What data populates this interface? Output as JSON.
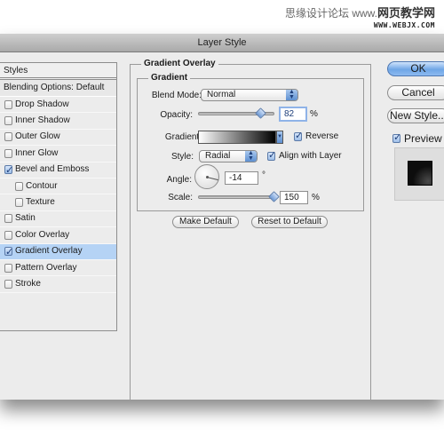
{
  "watermark": {
    "line1_prefix": "思缘设计论坛",
    "line1_www": "www.",
    "line1_site": "网页教学网",
    "line2": "WWW.WEBJX.COM"
  },
  "window": {
    "title": "Layer Style"
  },
  "styles_list": {
    "header": "Styles",
    "blending_options": "Blending Options: Default",
    "items": [
      {
        "label": "Drop Shadow",
        "checked": false,
        "sub": false,
        "selected": false
      },
      {
        "label": "Inner Shadow",
        "checked": false,
        "sub": false,
        "selected": false
      },
      {
        "label": "Outer Glow",
        "checked": false,
        "sub": false,
        "selected": false
      },
      {
        "label": "Inner Glow",
        "checked": false,
        "sub": false,
        "selected": false
      },
      {
        "label": "Bevel and Emboss",
        "checked": true,
        "sub": false,
        "selected": false
      },
      {
        "label": "Contour",
        "checked": false,
        "sub": true,
        "selected": false
      },
      {
        "label": "Texture",
        "checked": false,
        "sub": true,
        "selected": false
      },
      {
        "label": "Satin",
        "checked": false,
        "sub": false,
        "selected": false
      },
      {
        "label": "Color Overlay",
        "checked": false,
        "sub": false,
        "selected": false
      },
      {
        "label": "Gradient Overlay",
        "checked": true,
        "sub": false,
        "selected": true
      },
      {
        "label": "Pattern Overlay",
        "checked": false,
        "sub": false,
        "selected": false
      },
      {
        "label": "Stroke",
        "checked": false,
        "sub": false,
        "selected": false
      }
    ]
  },
  "panel": {
    "title": "Gradient Overlay",
    "group_title": "Gradient",
    "blend_mode_label": "Blend Mode:",
    "blend_mode_value": "Normal",
    "opacity_label": "Opacity:",
    "opacity_value": "82",
    "opacity_percent": 82,
    "opacity_unit": "%",
    "gradient_label": "Gradient:",
    "gradient_colors": [
      "#ffffff",
      "#000000"
    ],
    "reverse_label": "Reverse",
    "reverse_checked": true,
    "style_label": "Style:",
    "style_value": "Radial",
    "align_label": "Align with Layer",
    "align_checked": true,
    "angle_label": "Angle:",
    "angle_value": "-14",
    "angle_unit": "°",
    "scale_label": "Scale:",
    "scale_value": "150",
    "scale_percent": 150,
    "scale_range": [
      10,
      150
    ],
    "scale_unit": "%",
    "make_default": "Make Default",
    "reset_default": "Reset to Default"
  },
  "side": {
    "ok": "OK",
    "cancel": "Cancel",
    "new_style": "New Style...",
    "preview_label": "Preview",
    "preview_checked": true
  }
}
